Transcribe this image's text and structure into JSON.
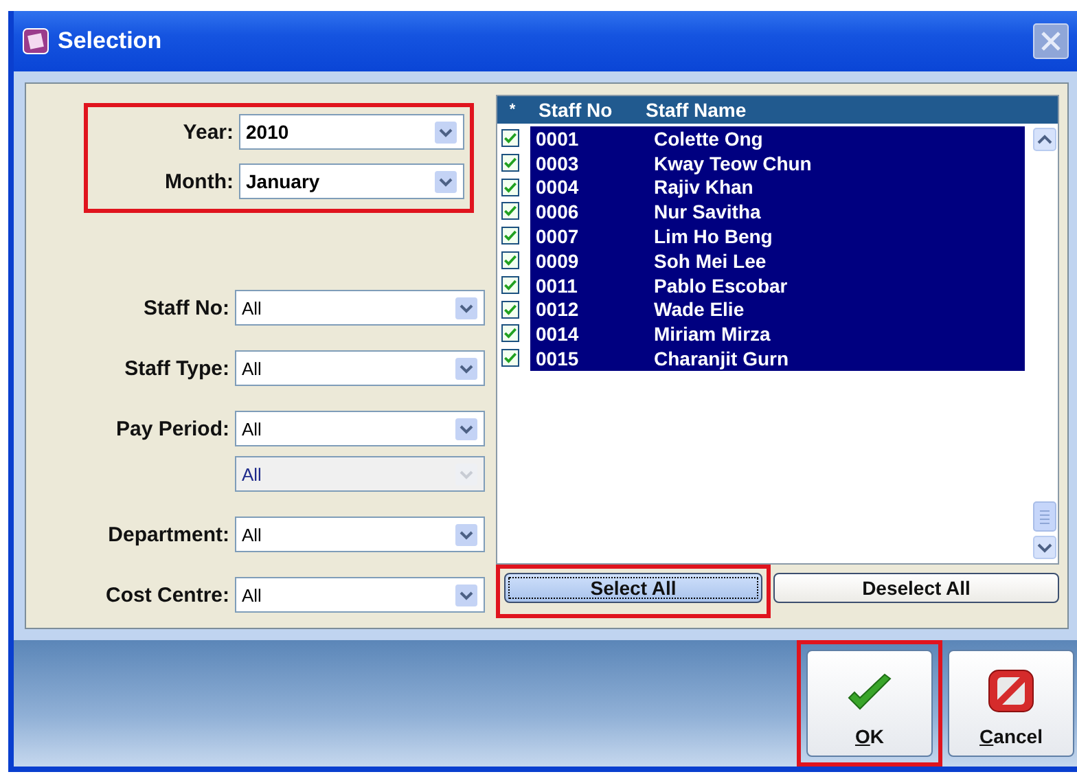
{
  "window": {
    "title": "Selection"
  },
  "filters": [
    {
      "label": "Year:",
      "value": "2010",
      "kind": "combo",
      "bold": true,
      "disabled": false,
      "highlighted": true
    },
    {
      "label": "Month:",
      "value": "January",
      "kind": "combo",
      "bold": true,
      "disabled": false,
      "highlighted": true
    },
    {
      "label": "Staff No:",
      "value": "All",
      "kind": "combo",
      "bold": false,
      "disabled": false,
      "highlighted": false
    },
    {
      "label": "Staff Type:",
      "value": "All",
      "kind": "combo",
      "bold": false,
      "disabled": false,
      "highlighted": false
    },
    {
      "label": "Pay Period:",
      "value": "All",
      "kind": "combo",
      "bold": false,
      "disabled": false,
      "highlighted": false
    },
    {
      "value": "All",
      "kind": "combo",
      "bold": false,
      "disabled": true,
      "highlighted": false
    },
    {
      "label": "Department:",
      "value": "All",
      "kind": "combo",
      "bold": false,
      "disabled": false,
      "highlighted": false
    },
    {
      "label": "Cost Centre:",
      "value": "All",
      "kind": "combo",
      "bold": false,
      "disabled": false,
      "highlighted": false
    }
  ],
  "staff_list": {
    "columns": [
      "*",
      "Staff No",
      "Staff Name"
    ],
    "rows": [
      {
        "staff_no": "0001",
        "name": "Colette Ong",
        "checked": true,
        "selected": true
      },
      {
        "staff_no": "0003",
        "name": "Kway Teow Chun",
        "checked": true,
        "selected": true
      },
      {
        "staff_no": "0004",
        "name": "Rajiv Khan",
        "checked": true,
        "selected": true
      },
      {
        "staff_no": "0006",
        "name": "Nur Savitha",
        "checked": true,
        "selected": true
      },
      {
        "staff_no": "0007",
        "name": "Lim Ho Beng",
        "checked": true,
        "selected": true
      },
      {
        "staff_no": "0009",
        "name": "Soh Mei Lee",
        "checked": true,
        "selected": true
      },
      {
        "staff_no": "0011",
        "name": "Pablo Escobar",
        "checked": true,
        "selected": true
      },
      {
        "staff_no": "0012",
        "name": "Wade Elie",
        "checked": true,
        "selected": true
      },
      {
        "staff_no": "0014",
        "name": "Miriam Mirza",
        "checked": true,
        "selected": true
      },
      {
        "staff_no": "0015",
        "name": "Charanjit Gurn",
        "checked": true,
        "selected": true
      }
    ],
    "buttons": [
      {
        "label": "Select All",
        "highlighted": true
      },
      {
        "label": "Deselect All",
        "highlighted": false
      }
    ]
  },
  "footer_buttons": [
    {
      "label": "OK",
      "kind": "ok",
      "highlighted": true
    },
    {
      "label": "Cancel",
      "kind": "cancel",
      "highlighted": false
    }
  ]
}
